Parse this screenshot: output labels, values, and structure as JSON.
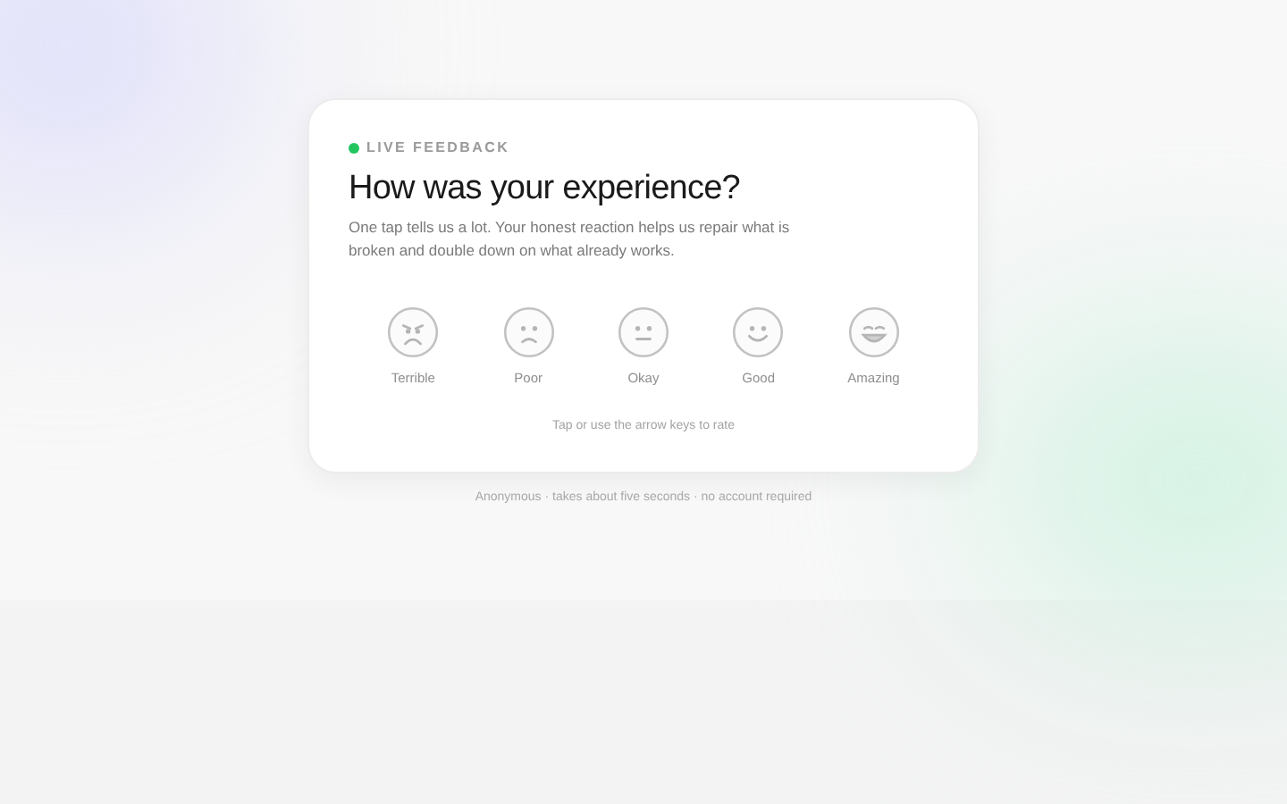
{
  "card": {
    "eyebrow": "LIVE FEEDBACK",
    "title": "How was your experience?",
    "description": "One tap tells us a lot. Your honest reaction helps us repair what is broken and double down on what already works.",
    "ratings": [
      {
        "kind": "terrible",
        "label": "Terrible"
      },
      {
        "kind": "poor",
        "label": "Poor"
      },
      {
        "kind": "okay",
        "label": "Okay"
      },
      {
        "kind": "good",
        "label": "Good"
      },
      {
        "kind": "amazing",
        "label": "Amazing"
      }
    ],
    "hint": "Tap or use the arrow keys to rate"
  },
  "footer": "Anonymous · takes about five seconds · no account required"
}
